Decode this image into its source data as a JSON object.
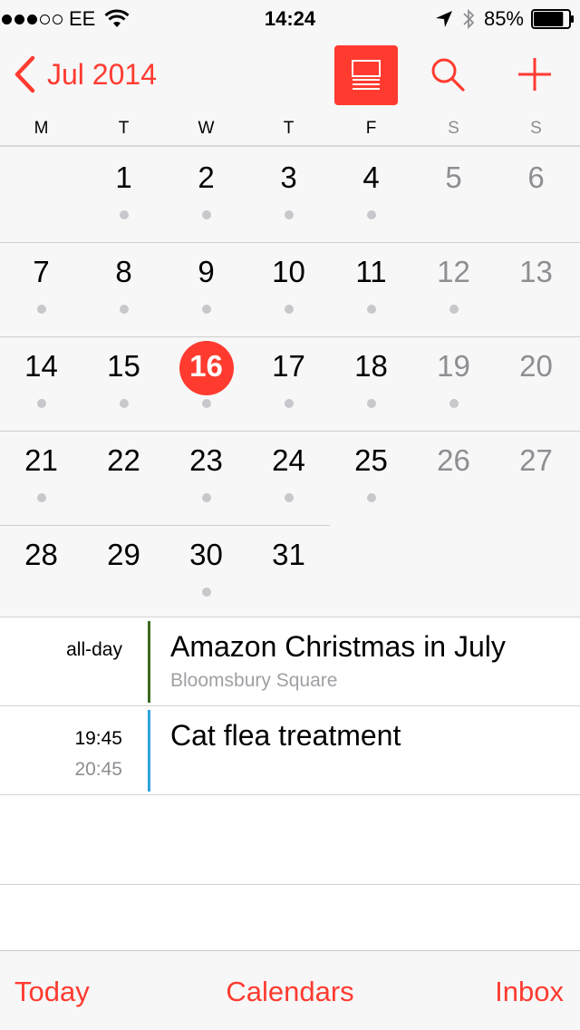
{
  "status_bar": {
    "carrier": "EE",
    "time": "14:24",
    "battery": "85%",
    "battery_level": 0.85,
    "signal_bars_filled": 3,
    "signal_bars_total": 5
  },
  "nav": {
    "back_label": "Jul 2014",
    "icons": [
      "chevron-left-icon",
      "list-view-icon",
      "search-icon",
      "plus-icon"
    ]
  },
  "weekdays": [
    "M",
    "T",
    "W",
    "T",
    "F",
    "S",
    "S"
  ],
  "calendar": {
    "month": "Jul 2014",
    "today": 16,
    "weeks": [
      [
        null,
        1,
        2,
        3,
        4,
        5,
        6
      ],
      [
        7,
        8,
        9,
        10,
        11,
        12,
        13
      ],
      [
        14,
        15,
        16,
        17,
        18,
        19,
        20
      ],
      [
        21,
        22,
        23,
        24,
        25,
        26,
        27
      ],
      [
        28,
        29,
        30,
        31,
        null,
        null,
        null
      ]
    ],
    "days_with_events": [
      1,
      2,
      3,
      4,
      7,
      8,
      9,
      10,
      11,
      12,
      14,
      15,
      16,
      17,
      18,
      19,
      21,
      23,
      24,
      25,
      30
    ]
  },
  "events": [
    {
      "time": "all-day",
      "title": "Amazon Christmas in July",
      "location": "Bloomsbury Square",
      "color": "#3c6a1f"
    },
    {
      "time": "19:45",
      "end_time": "20:45",
      "title": "Cat flea treatment",
      "color": "#2ea4dc"
    }
  ],
  "tab_bar": {
    "today": "Today",
    "calendars": "Calendars",
    "inbox": "Inbox"
  },
  "colors": {
    "accent": "#ff3b30",
    "weekend_text": "#8e8e93",
    "dot": "#c7c7cc"
  }
}
